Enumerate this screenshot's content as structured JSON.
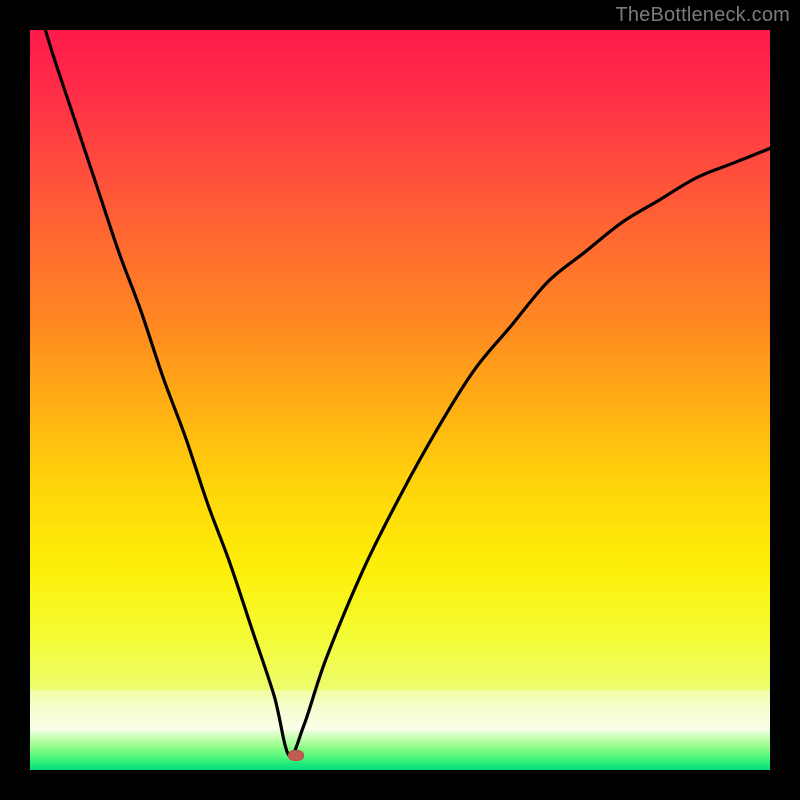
{
  "watermark": "TheBottleneck.com",
  "chart_data": {
    "type": "line",
    "title": "",
    "xlabel": "",
    "ylabel": "",
    "xlim": [
      0,
      100
    ],
    "ylim": [
      0,
      100
    ],
    "grid": false,
    "curve_minimum": {
      "x": 35,
      "y": 2
    },
    "marker": {
      "x": 36,
      "y": 2,
      "color": "#c15e52"
    },
    "series": [
      {
        "name": "bottleneck-curve",
        "x": [
          0,
          3,
          6,
          9,
          12,
          15,
          18,
          21,
          24,
          27,
          30,
          33,
          35,
          37,
          40,
          45,
          50,
          55,
          60,
          65,
          70,
          75,
          80,
          85,
          90,
          95,
          100
        ],
        "values": [
          107,
          97,
          88,
          79,
          70,
          62,
          53,
          45,
          36,
          28,
          19,
          10,
          2,
          6,
          15,
          27,
          37,
          46,
          54,
          60,
          66,
          70,
          74,
          77,
          80,
          82,
          84
        ]
      }
    ],
    "background_gradient": {
      "stops": [
        {
          "pos": 0.0,
          "color": "#ff1a4b"
        },
        {
          "pos": 0.45,
          "color": "#ff8a21"
        },
        {
          "pos": 0.82,
          "color": "#fcf008"
        },
        {
          "pos": 0.92,
          "color": "#f2fca0"
        },
        {
          "pos": 0.96,
          "color": "#8bfd86"
        },
        {
          "pos": 1.0,
          "color": "#09dd80"
        }
      ]
    }
  }
}
